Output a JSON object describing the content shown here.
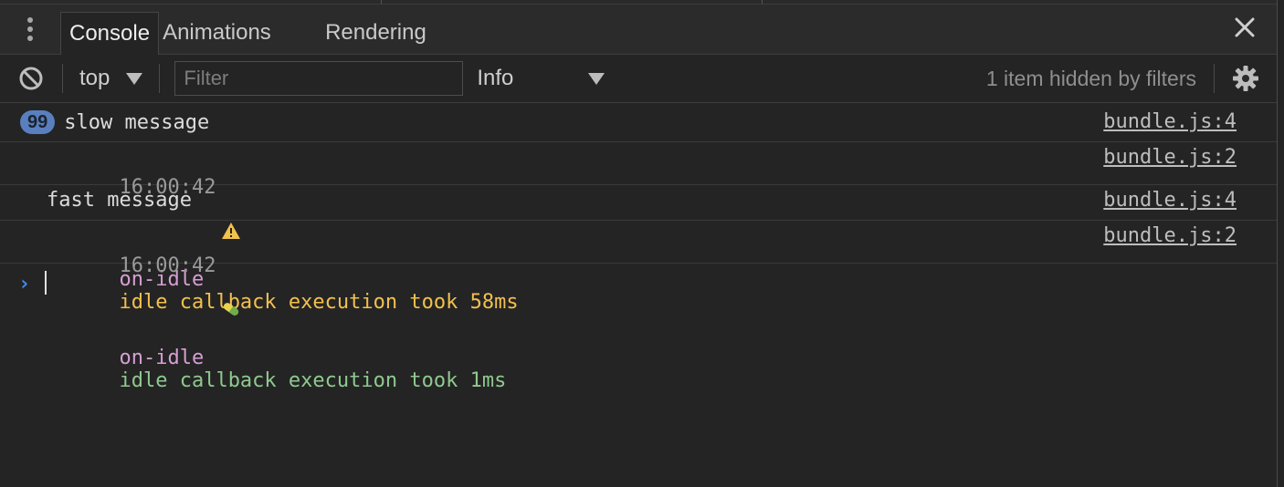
{
  "tabs": [
    {
      "label": "Console",
      "active": true
    },
    {
      "label": "Animations",
      "active": false
    },
    {
      "label": "Rendering",
      "active": false
    }
  ],
  "toolbar": {
    "context": "top",
    "filter_placeholder": "Filter",
    "filter_value": "",
    "level": "Info",
    "hidden_message": "1 item hidden by filters"
  },
  "messages": [
    {
      "count": "99",
      "text": "slow message",
      "source": "bundle.js:4"
    },
    {
      "timestamp": "16:00:42",
      "icon": "warning-icon",
      "tag": "on-idle",
      "text": "idle callback execution took 58ms",
      "source": "bundle.js:2"
    },
    {
      "text": "fast message",
      "source": "bundle.js:4"
    },
    {
      "timestamp": "16:00:42",
      "icon": "pill-icon",
      "tag": "on-idle",
      "text": "idle callback execution took 1ms",
      "source": "bundle.js:2"
    }
  ],
  "colors": {
    "background": "#242424",
    "warning": "#f2c04e",
    "success": "#8fc98f",
    "tag": "#d69fd4",
    "prompt": "#3d8bff",
    "badge": "#5a7fbf"
  }
}
